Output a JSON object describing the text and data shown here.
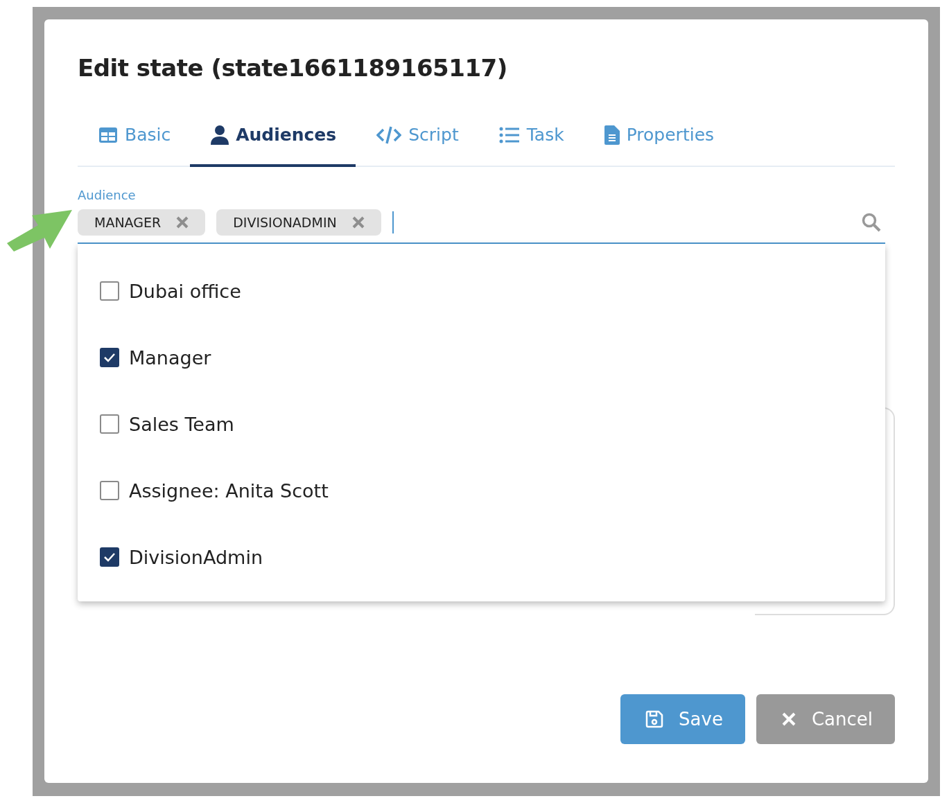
{
  "dialog": {
    "title": "Edit state (state1661189165117)"
  },
  "tabs": [
    {
      "label": "Basic",
      "selected": false
    },
    {
      "label": "Audiences",
      "selected": true
    },
    {
      "label": "Script",
      "selected": false
    },
    {
      "label": "Task",
      "selected": false
    },
    {
      "label": "Properties",
      "selected": false
    }
  ],
  "audience_field": {
    "label": "Audience",
    "tags": [
      "MANAGER",
      "DIVISIONADMIN"
    ]
  },
  "options": [
    {
      "label": "Dubai office",
      "checked": false
    },
    {
      "label": "Manager",
      "checked": true
    },
    {
      "label": "Sales Team",
      "checked": false
    },
    {
      "label": "Assignee: Anita Scott",
      "checked": false
    },
    {
      "label": "DivisionAdmin",
      "checked": true
    }
  ],
  "buttons": [
    {
      "kind": "save",
      "label": "Save"
    },
    {
      "kind": "cancel",
      "label": "Cancel"
    }
  ]
}
